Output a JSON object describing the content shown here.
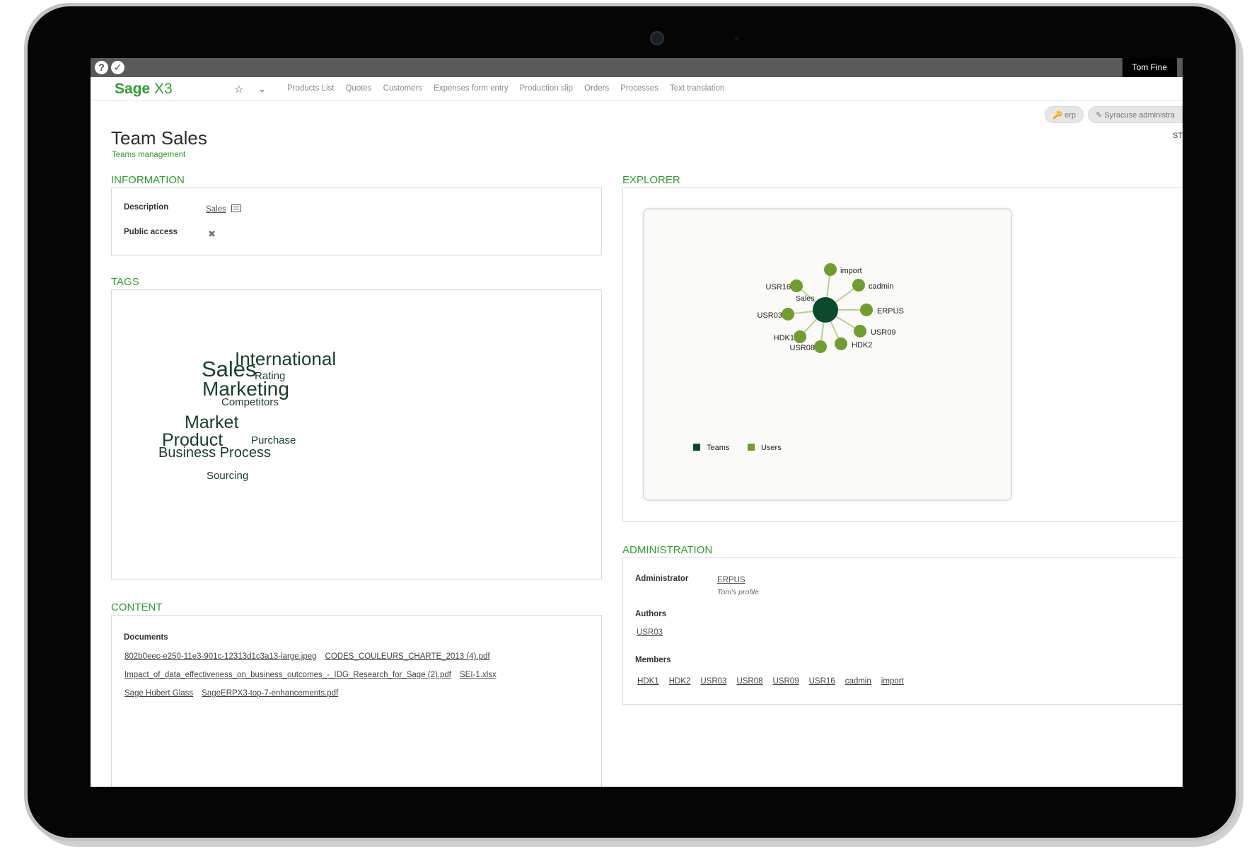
{
  "topbar": {
    "help_icon": "?",
    "app_icon": "✓",
    "user_name": "Tom Fine"
  },
  "navbar": {
    "logo_sage": "Sage",
    "logo_x3": "X3",
    "menu": [
      "Products List",
      "Quotes",
      "Customers",
      "Expenses form entry",
      "Production slip",
      "Orders",
      "Processes",
      "Text translation"
    ]
  },
  "endpoints": {
    "erp": "erp",
    "admin": "Syracuse administra",
    "st": "ST"
  },
  "page": {
    "title": "Team Sales",
    "subtitle": "Teams management"
  },
  "information": {
    "title": "INFORMATION",
    "description_label": "Description",
    "description_value": "Sales",
    "public_access_label": "Public access",
    "public_access_value": "✖"
  },
  "tags": {
    "title": "TAGS",
    "items": [
      "International",
      "Sales",
      "Rating",
      "Marketing",
      "Competitors",
      "Market",
      "Product",
      "Purchase",
      "Business Process",
      "Sourcing"
    ]
  },
  "content": {
    "title": "CONTENT",
    "documents_label": "Documents",
    "documents": [
      [
        "802b0eec-e250-11e3-901c-12313d1c3a13-large.jpeg",
        "CODES_COULEURS_CHARTE_2013 (4).pdf"
      ],
      [
        "Impact_of_data_effectiveness_on_business_outcomes_-_IDG_Research_for_Sage (2).pdf",
        "SEI-1.xlsx"
      ],
      [
        "Sage Hubert Glass",
        "SageERPX3-top-7-enhancements.pdf"
      ]
    ]
  },
  "explorer": {
    "title": "EXPLORER",
    "center_node": "Sales",
    "user_nodes": [
      "import",
      "cadmin",
      "ERPUS",
      "USR09",
      "HDK2",
      "USR08",
      "HDK1",
      "USR03",
      "USR16"
    ],
    "legend": {
      "teams": "Teams",
      "users": "Users"
    },
    "colors": {
      "team": "#0c4a30",
      "user": "#6f9e2f",
      "edge": "#b9cf8f"
    }
  },
  "administration": {
    "title": "ADMINISTRATION",
    "administrator_label": "Administrator",
    "administrator_value": "ERPUS",
    "administrator_profile": "Tom's profile",
    "authors_label": "Authors",
    "authors_value": "USR03",
    "members_label": "Members",
    "members": [
      "HDK1",
      "HDK2",
      "USR03",
      "USR08",
      "USR09",
      "USR16",
      "cadmin",
      "import"
    ]
  }
}
